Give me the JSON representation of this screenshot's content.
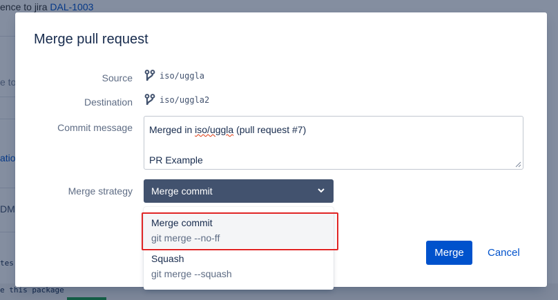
{
  "background": {
    "top_text": "ence to jira",
    "top_link": "DAL-1003",
    "fragment_1": "e to",
    "fragment_2": "atio",
    "fragment_3": "DM",
    "code_1": "tes",
    "code_2": "e this package"
  },
  "modal": {
    "title": "Merge pull request",
    "source": {
      "label": "Source",
      "branch": "iso/uggla"
    },
    "destination": {
      "label": "Destination",
      "branch": "iso/uggla2"
    },
    "commit_message": {
      "label": "Commit message",
      "line1_prefix": "Merged in ",
      "line1_branch": "iso/uggla",
      "line1_suffix": " (pull request #7)",
      "line2": "PR Example"
    },
    "merge_strategy": {
      "label": "Merge strategy",
      "selected": "Merge commit",
      "options": [
        {
          "title": "Merge commit",
          "description": "git merge --no-ff"
        },
        {
          "title": "Squash",
          "description": "git merge --squash"
        }
      ]
    },
    "buttons": {
      "merge": "Merge",
      "cancel": "Cancel"
    }
  },
  "colors": {
    "primary": "#0052cc",
    "select_bg": "#42526e",
    "highlight": "#e02424"
  }
}
